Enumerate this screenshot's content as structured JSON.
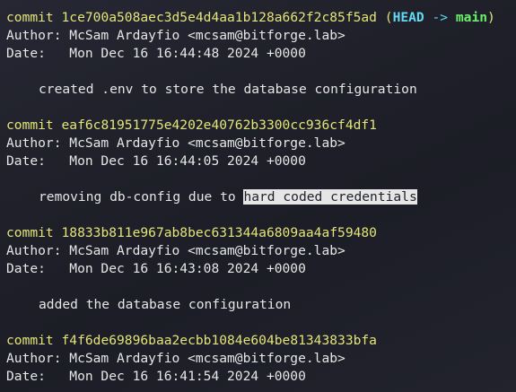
{
  "commits": [
    {
      "commit_label": "commit",
      "hash": "1ce700a508aec3d5e4d4aa1b128a662f2c85f5ad",
      "refs": {
        "open": "(",
        "head": "HEAD",
        "arrow": "->",
        "branch": "main",
        "close": ")"
      },
      "author_line": "Author: McSam Ardayfio <mcsam@bitforge.lab>",
      "date_line": "Date:   Mon Dec 16 16:44:48 2024 +0000",
      "message": "created .env to store the database configuration"
    },
    {
      "commit_label": "commit",
      "hash": "eaf6c81951775e4202e40762b3300cc936cf4df1",
      "author_line": "Author: McSam Ardayfio <mcsam@bitforge.lab>",
      "date_line": "Date:   Mon Dec 16 16:44:05 2024 +0000",
      "message_prefix": "removing db-config due to ",
      "message_highlight": "hard coded credentials"
    },
    {
      "commit_label": "commit",
      "hash": "18833b811e967ab8bec631344a6809aa4af59480",
      "author_line": "Author: McSam Ardayfio <mcsam@bitforge.lab>",
      "date_line": "Date:   Mon Dec 16 16:43:08 2024 +0000",
      "message": "added the database configuration"
    },
    {
      "commit_label": "commit",
      "hash": "f4f6de69896baa2ecbb1084e604be81343833bfa",
      "author_line": "Author: McSam Ardayfio <mcsam@bitforge.lab>",
      "date_line": "Date:   Mon Dec 16 16:41:54 2024 +0000"
    }
  ],
  "colors": {
    "background": "#1e1f29",
    "commit_yellow": "#e4e47a",
    "head_cyan": "#62d9f2",
    "branch_green": "#6bf06b",
    "text": "#e6e6e6",
    "selection_bg": "#e6e6e6"
  }
}
